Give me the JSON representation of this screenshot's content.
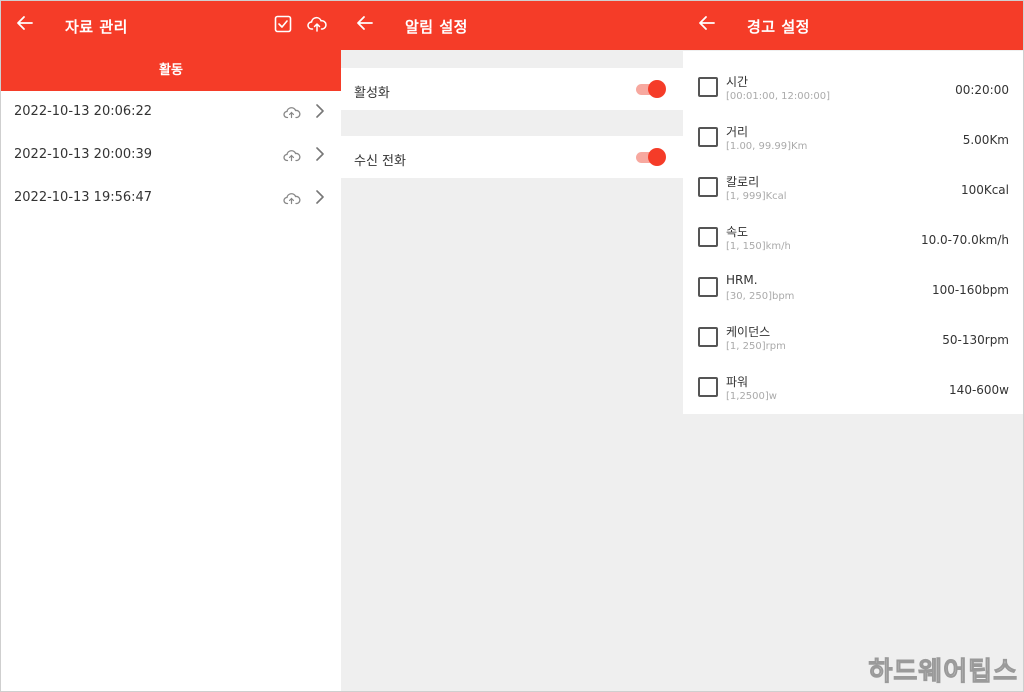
{
  "panels": {
    "data_management": {
      "title": "자료 관리",
      "tab": "활동",
      "records": [
        {
          "time": "2022-10-13 20:06:22"
        },
        {
          "time": "2022-10-13 20:00:39"
        },
        {
          "time": "2022-10-13 19:56:47"
        }
      ]
    },
    "notification_settings": {
      "title": "알림 설정",
      "items": [
        {
          "label": "활성화",
          "enabled": true
        },
        {
          "label": "수신 전화",
          "enabled": true
        }
      ]
    },
    "alert_settings": {
      "title": "경고 설정",
      "items": [
        {
          "name": "시간",
          "range": "[00:01:00, 12:00:00]",
          "value": "00:20:00",
          "checked": false
        },
        {
          "name": "거리",
          "range": "[1.00, 99.99]Km",
          "value": "5.00Km",
          "checked": false
        },
        {
          "name": "칼로리",
          "range": "[1, 999]Kcal",
          "value": "100Kcal",
          "checked": false
        },
        {
          "name": "속도",
          "range": "[1, 150]km/h",
          "value": "10.0-70.0km/h",
          "checked": false
        },
        {
          "name": "HRM.",
          "range": "[30, 250]bpm",
          "value": "100-160bpm",
          "checked": false
        },
        {
          "name": "케이던스",
          "range": "[1, 250]rpm",
          "value": "50-130rpm",
          "checked": false
        },
        {
          "name": "파워",
          "range": "[1,2500]w",
          "value": "140-600w",
          "checked": false
        }
      ]
    }
  },
  "watermark": "하드웨어팁스",
  "colors": {
    "accent": "#f53c28",
    "toggle_track": "#f7a89f",
    "background": "#efefef"
  },
  "icons": {
    "back": "arrow-left-icon",
    "select_all": "checkbox-checked-icon",
    "upload": "cloud-upload-icon",
    "sync": "cloud-sync-icon",
    "chevron": "chevron-right-icon"
  }
}
